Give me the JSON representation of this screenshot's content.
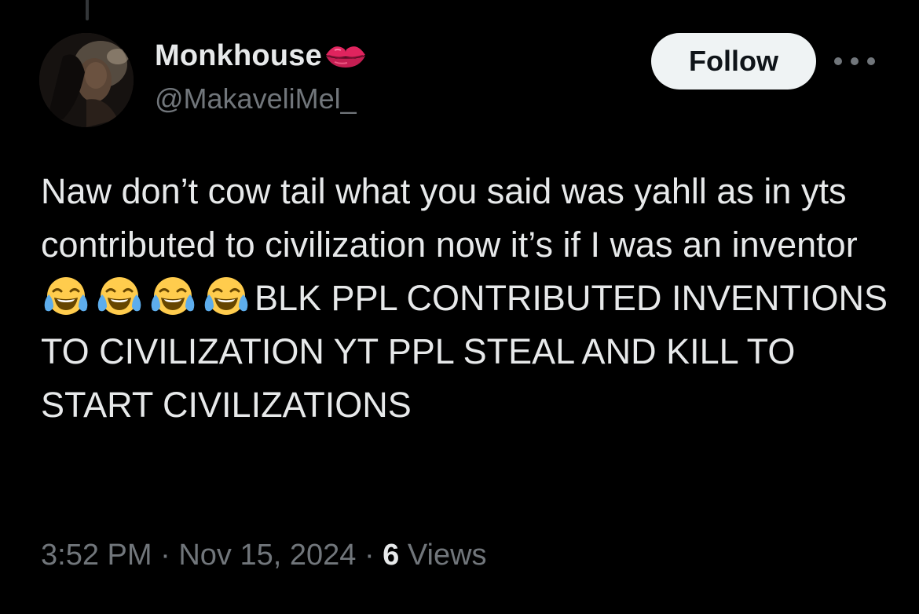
{
  "author": {
    "display_name": "Monkhouse",
    "handle": "@MakaveliMel_",
    "name_badge_icon": "kiss-lips-icon"
  },
  "actions": {
    "follow_label": "Follow",
    "more_icon": "more-options-icon"
  },
  "tweet": {
    "text_part1": "Naw don’t cow tail what you said was yahll as in yts contributed to civilization now it’s if I was an inventor",
    "emoji_name": "face-with-tears-of-joy-icon",
    "emoji_count": 4,
    "text_part2": "BLK PPL CONTRIBUTED INVENTIONS TO CIVILIZATION YT PPL STEAL AND KILL TO START CIVILIZATIONS"
  },
  "meta": {
    "time": "3:52 PM",
    "separator": "·",
    "date": "Nov 15, 2024",
    "views_count": "6",
    "views_label": "Views"
  },
  "colors": {
    "background": "#000000",
    "primary_text": "#e7e9ea",
    "secondary_text": "#71767b",
    "follow_bg": "#eff3f4",
    "follow_text": "#0f1419",
    "lips": "#e0245e"
  }
}
